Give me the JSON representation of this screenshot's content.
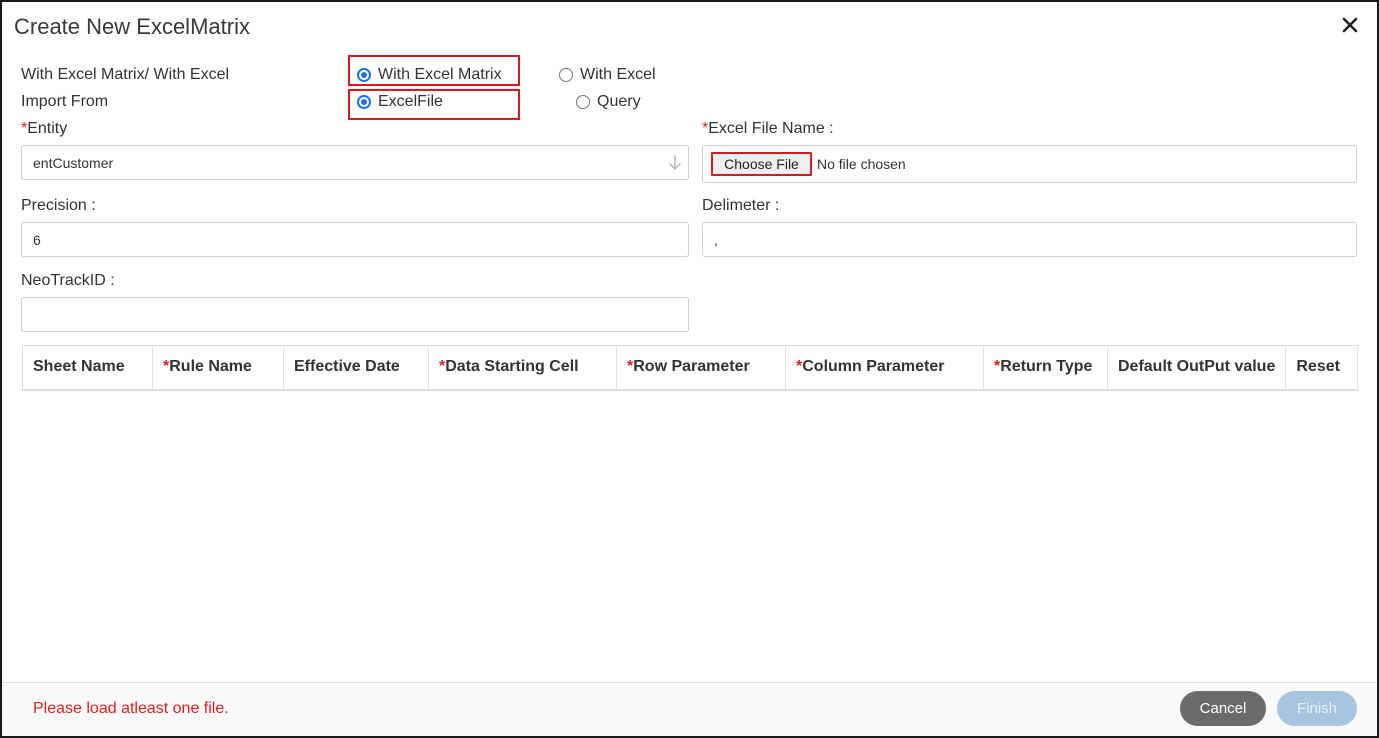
{
  "dialog": {
    "title": "Create New ExcelMatrix",
    "close_icon": "close-icon"
  },
  "mode": {
    "label": "With Excel Matrix/ With Excel",
    "options": [
      {
        "label": "With Excel Matrix",
        "checked": true
      },
      {
        "label": "With Excel",
        "checked": false
      }
    ]
  },
  "import_from": {
    "label": "Import From",
    "options": [
      {
        "label": "ExcelFile",
        "checked": true
      },
      {
        "label": "Query",
        "checked": false
      }
    ]
  },
  "entity": {
    "required_mark": "*",
    "label": "Entity",
    "value": "entCustomer",
    "arrow_icon": "arrow-down-icon"
  },
  "excel_file": {
    "required_mark": "*",
    "label": "Excel File Name :",
    "button_label": "Choose File",
    "status": "No file chosen"
  },
  "precision": {
    "label": "Precision :",
    "value": "6"
  },
  "delimeter": {
    "label": "Delimeter :",
    "value": ","
  },
  "neotrack": {
    "label": "NeoTrackID :",
    "value": ""
  },
  "table": {
    "columns": [
      {
        "required": "",
        "label": "Sheet Name"
      },
      {
        "required": "*",
        "label": "Rule Name"
      },
      {
        "required": "",
        "label": "Effective Date"
      },
      {
        "required": "*",
        "label": "Data Starting Cell"
      },
      {
        "required": "*",
        "label": "Row Parameter"
      },
      {
        "required": "*",
        "label": "Column Parameter"
      },
      {
        "required": "*",
        "label": "Return Type"
      },
      {
        "required": "",
        "label": "Default OutPut value"
      },
      {
        "required": "",
        "label": "Reset"
      }
    ]
  },
  "footer": {
    "error_message": "Please load atleast one file.",
    "cancel_label": "Cancel",
    "finish_label": "Finish"
  },
  "colors": {
    "required": "#e01e1e",
    "highlight": "#d71920",
    "radio_accent": "#1a73e8",
    "cancel_bg": "#6b6b6b",
    "finish_bg": "#a9c4df"
  }
}
